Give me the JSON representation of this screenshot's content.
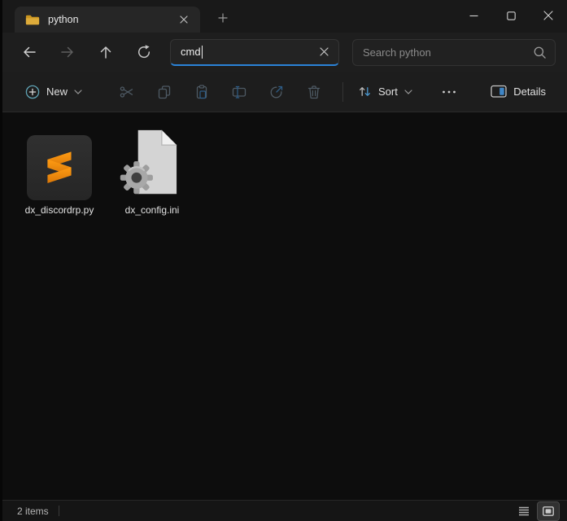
{
  "titlebar": {
    "tab_label": "python"
  },
  "navigation": {
    "address_value": "cmd",
    "search_placeholder": "Search python"
  },
  "toolbar": {
    "new_label": "New",
    "sort_label": "Sort",
    "details_label": "Details"
  },
  "content": {
    "files": [
      {
        "name": "dx_discordrp.py",
        "icon": "sublime-text-icon"
      },
      {
        "name": "dx_config.ini",
        "icon": "config-file-icon"
      }
    ]
  },
  "statusbar": {
    "items_count": "2 items"
  },
  "colors": {
    "accent_blue": "#2a83d8",
    "sublime_orange": "#e8860d",
    "folder_yellow": "#d9a440"
  }
}
